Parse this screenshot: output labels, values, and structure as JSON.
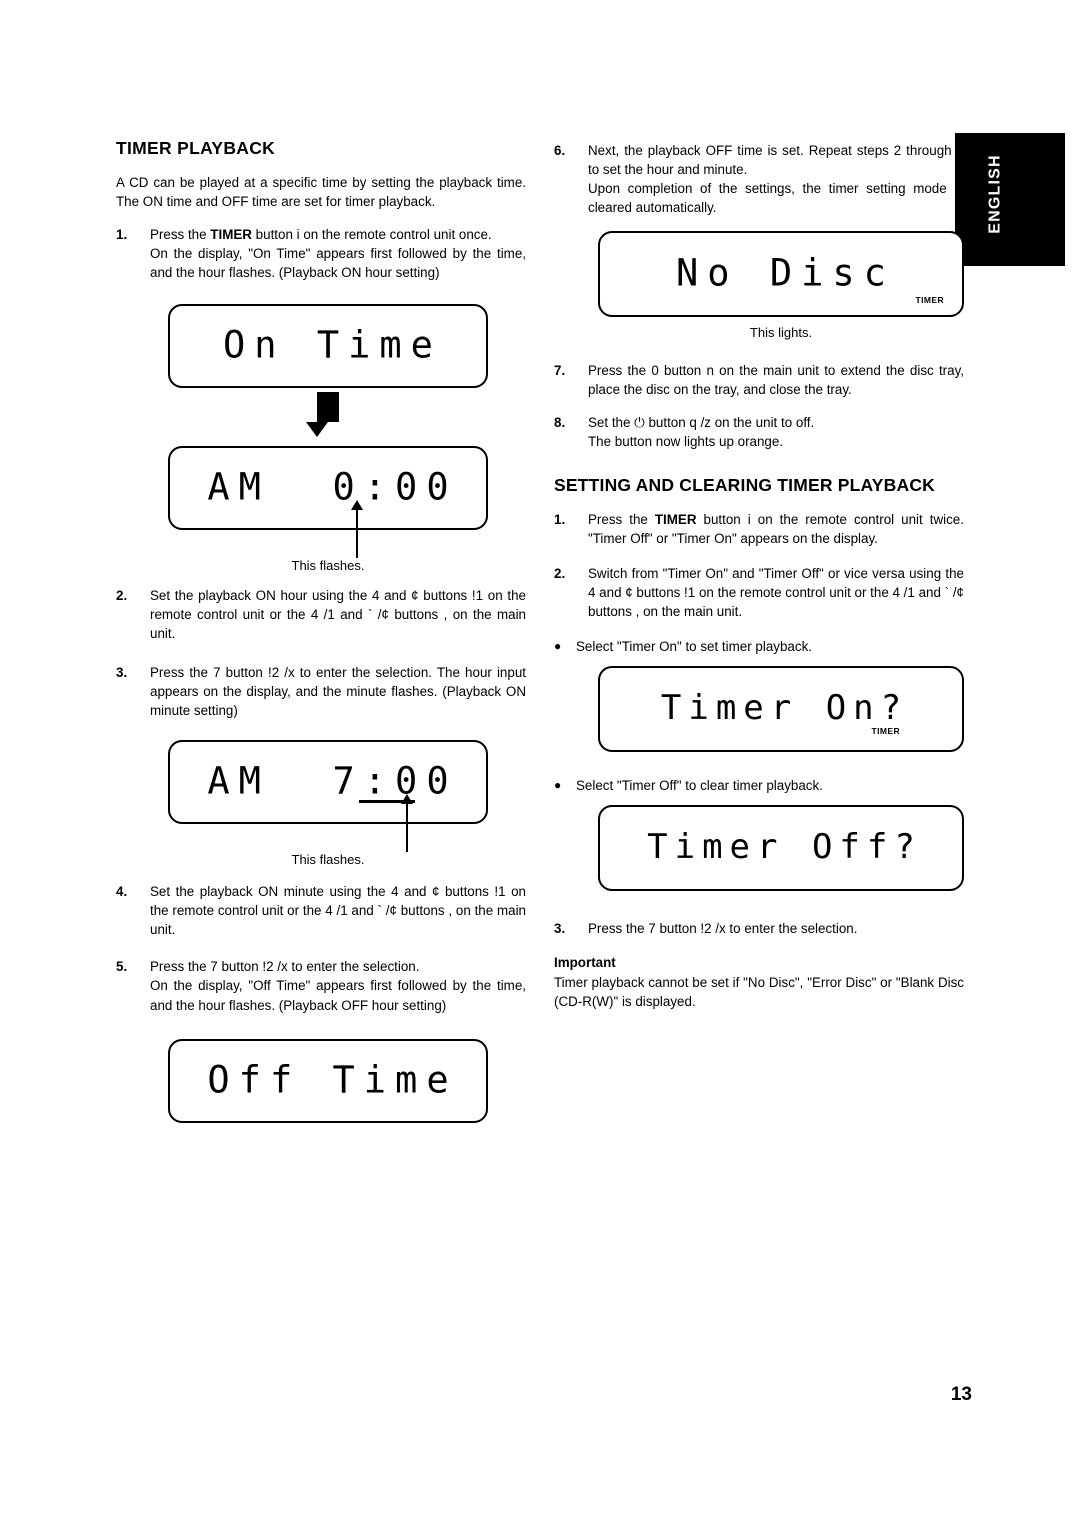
{
  "side_tab": {
    "label": "ENGLISH"
  },
  "page_number": "13",
  "left": {
    "heading": "TIMER PLAYBACK",
    "intro": "A CD can be played at a specific time by setting the playback time.  The ON time and OFF time are set for timer playback.",
    "steps": [
      {
        "num": "1.",
        "line1_a": "Press the ",
        "line1_b": "TIMER",
        "line1_c": " button i  on the remote control unit once.",
        "line2": "On the display, \"On Time\" appears first followed by the time, and the hour flashes.  (Playback ON hour setting)"
      },
      {
        "num": "2.",
        "line1": "Set the playback ON hour using the 4      and ¢      buttons !1  on the remote control unit or the 4    /1    and `    /¢ buttons ,   on the main unit."
      },
      {
        "num": "3.",
        "line1": "Press the 7  button !2 /x   to enter the selection.  The hour input appears on the display, and the minute flashes.  (Playback ON minute setting)"
      },
      {
        "num": "4.",
        "line1": "Set the playback ON minute using the 4      and ¢      buttons !1  on the remote control unit or the 4    /1    and `    /¢ buttons ,   on the main unit."
      },
      {
        "num": "5.",
        "line1": "Press the 7  button !2 /x   to enter the selection.",
        "line2": "On the display, \"Off Time\" appears first followed by the time, and the hour flashes.  (Playback OFF hour setting)"
      }
    ],
    "displays": [
      {
        "text": "On Time",
        "caption": ""
      },
      {
        "text": "AM  0:00",
        "caption": "This flashes."
      },
      {
        "text": "AM  7:00",
        "caption": "This flashes."
      },
      {
        "text": "Off Time",
        "caption": ""
      }
    ]
  },
  "right": {
    "steps_top": [
      {
        "num": "6.",
        "line1": "Next, the playback OFF time is set.  Repeat steps 2 through 5 to set the hour and minute.",
        "line2": "Upon completion of the settings, the timer setting mode is cleared automatically."
      },
      {
        "num": "7.",
        "line1": "Press the 0  button n  on the main unit to extend the disc tray, place the disc on the tray, and close the tray."
      },
      {
        "num": "8.",
        "line1": "Set the ⏻ button q /z   on the unit to off.",
        "line2": "The button now lights up orange."
      }
    ],
    "display_nodisc": {
      "text": "No Disc",
      "timer_label": "TIMER",
      "caption": "This lights."
    },
    "heading2": "SETTING AND CLEARING TIMER PLAYBACK",
    "steps_bottom": [
      {
        "num": "1.",
        "line1_a": "Press the ",
        "line1_b": "TIMER",
        "line1_c": " button i   on the remote control unit twice.  \"Timer Off\" or \"Timer On\" appears on the display."
      },
      {
        "num": "2.",
        "line1": "Switch from \"Timer On\" and \"Timer Off\" or vice versa using the 4      and ¢      buttons !1  on the remote control unit or the 4    /1    and `    /¢     buttons ,   on the main unit."
      }
    ],
    "bullets": [
      {
        "text": "Select \"Timer On\" to set timer playback."
      },
      {
        "text": "Select \"Timer Off\" to clear timer playback."
      }
    ],
    "display_timer_on": {
      "text": "Timer On?",
      "timer_label": "TIMER"
    },
    "display_timer_off": {
      "text": "Timer Off?"
    },
    "step_last": {
      "num": "3.",
      "line1": "Press the 7  button !2 /x   to enter the selection."
    },
    "important_heading": "Important",
    "important_text": "Timer playback cannot be set if \"No Disc\", \"Error Disc\" or \"Blank Disc (CD-R(W)\" is displayed."
  }
}
